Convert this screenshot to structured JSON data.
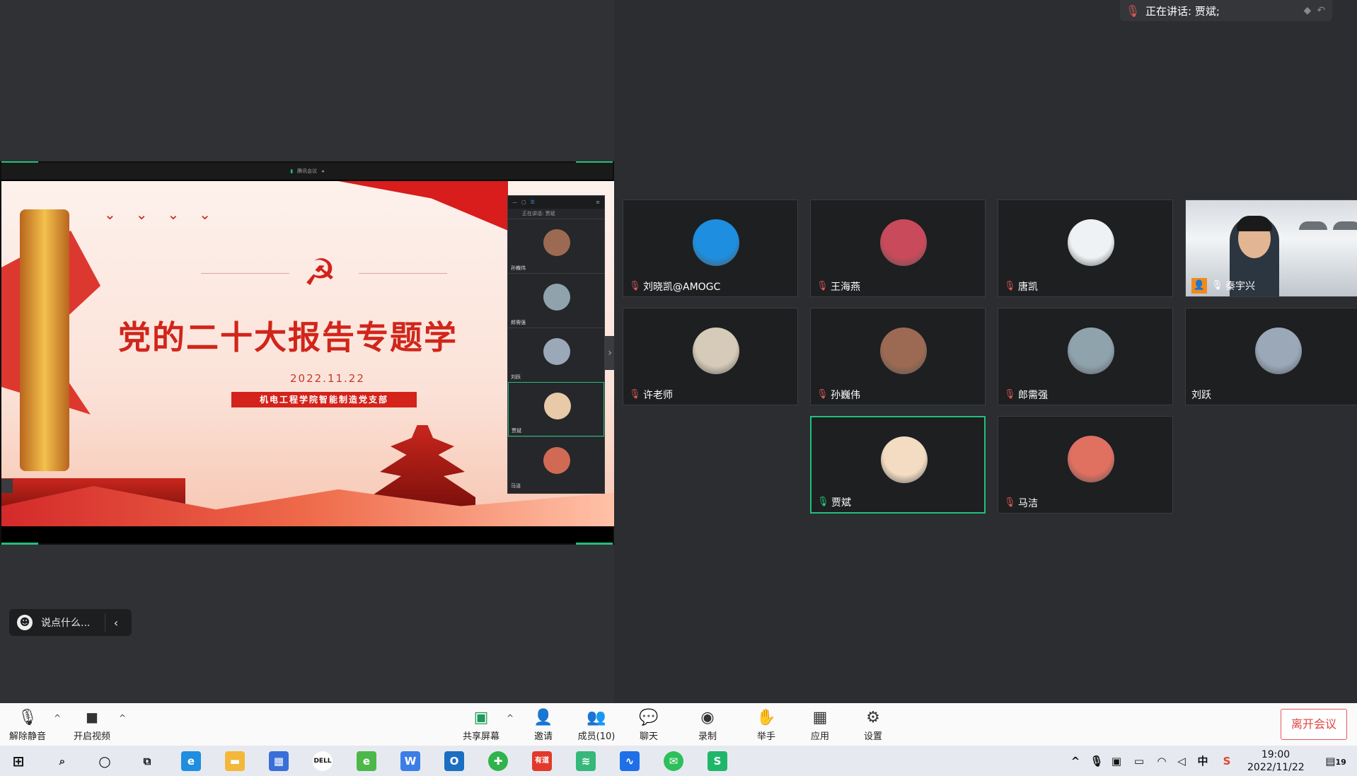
{
  "shared": {
    "topbar_label": "腾讯会议",
    "slide": {
      "title": "党的二十大报告专题学",
      "date": "2022.11.22",
      "org": "机电工程学院智能制造党支部"
    },
    "mini_panel": {
      "speaking": "正在讲话: 贾斌",
      "tiles": [
        {
          "name": "孙巍伟",
          "color": "#9c6a52"
        },
        {
          "name": "郎需强",
          "color": "#8fa3ad"
        },
        {
          "name": "刘跃",
          "color": "#9aa8b8"
        },
        {
          "name": "贾斌",
          "color": "#e8c9a8"
        },
        {
          "name": "马洁",
          "color": "#d06a55"
        }
      ]
    }
  },
  "chat": {
    "placeholder": "说点什么..."
  },
  "speaking_banner": {
    "text": "正在讲话: 贾斌;"
  },
  "participants": [
    {
      "name": "刘晓凯@AMOGC",
      "muted": true,
      "color": "#1e8fe0"
    },
    {
      "name": "王海燕",
      "muted": true,
      "color": "#c94a5a"
    },
    {
      "name": "唐凯",
      "muted": true,
      "color": "#eef2f5"
    },
    {
      "name": "秦宇兴",
      "muted": true,
      "video": true
    },
    {
      "name": "许老师",
      "muted": true,
      "color": "#d6cbb8"
    },
    {
      "name": "孙巍伟",
      "muted": true,
      "color": "#9c6a52"
    },
    {
      "name": "郎需强",
      "muted": true,
      "color": "#8fa3ad"
    },
    {
      "name": "刘跃",
      "muted": false,
      "no_mic": true,
      "color": "#9aa8b8"
    },
    {
      "name": "贾斌",
      "muted": false,
      "speaking": true,
      "color": "#f3dcc2"
    },
    {
      "name": "马洁",
      "muted": true,
      "color": "#e07060"
    }
  ],
  "toolbar": {
    "unmute": "解除静音",
    "start_video": "开启视频",
    "share": "共享屏幕",
    "invite": "邀请",
    "members": "成员(10)",
    "chat": "聊天",
    "record": "录制",
    "raise_hand": "举手",
    "apps": "应用",
    "settings": "设置",
    "leave": "离开会议"
  },
  "taskbar": {
    "time": "19:00",
    "date": "2022/11/22",
    "notification_count": "19",
    "ime": "中"
  },
  "colors": {
    "accent_green": "#22c07a",
    "leave_red": "#e0433f",
    "slide_red": "#d1251b"
  }
}
